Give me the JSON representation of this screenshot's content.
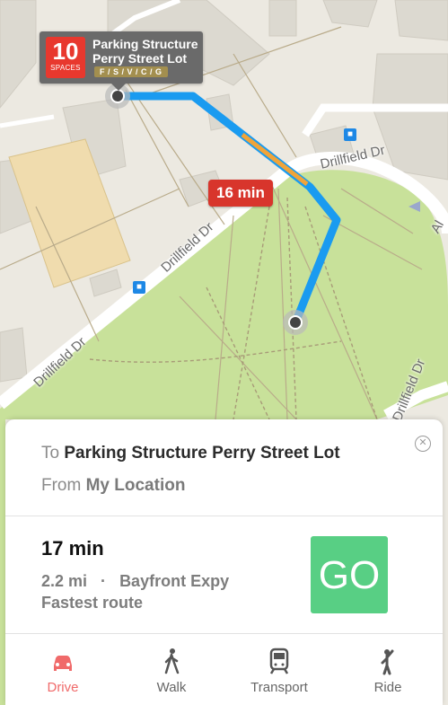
{
  "map": {
    "callout": {
      "spaces_count": "10",
      "spaces_label": "SPACES",
      "name": "Parking Structure Perry Street Lot",
      "permits": "F / S / V / C / G"
    },
    "time_badge": "16 min",
    "streets": [
      "Drillfield Dr",
      "Drillfield Dr",
      "Drillfield Dr",
      "Drillfield Dr",
      "Al"
    ],
    "colors": {
      "route": "#1a9bf0",
      "traffic": "#f0a43a",
      "grass": "#c8e19a",
      "badge": "#d8352c"
    }
  },
  "directions": {
    "to_prefix": "To",
    "to_name": "Parking Structure Perry Street Lot",
    "from_prefix": "From",
    "from_name": "My Location",
    "eta": "17 min",
    "distance": "2.2 mi",
    "separator": "·",
    "via": "Bayfront Expy",
    "route_note": "Fastest route",
    "go_label": "GO",
    "close_icon": "close-icon"
  },
  "tabs": [
    {
      "label": "Drive",
      "icon": "car-icon",
      "active": true
    },
    {
      "label": "Walk",
      "icon": "walk-icon",
      "active": false
    },
    {
      "label": "Transport",
      "icon": "train-icon",
      "active": false
    },
    {
      "label": "Ride",
      "icon": "ride-icon",
      "active": false
    }
  ]
}
